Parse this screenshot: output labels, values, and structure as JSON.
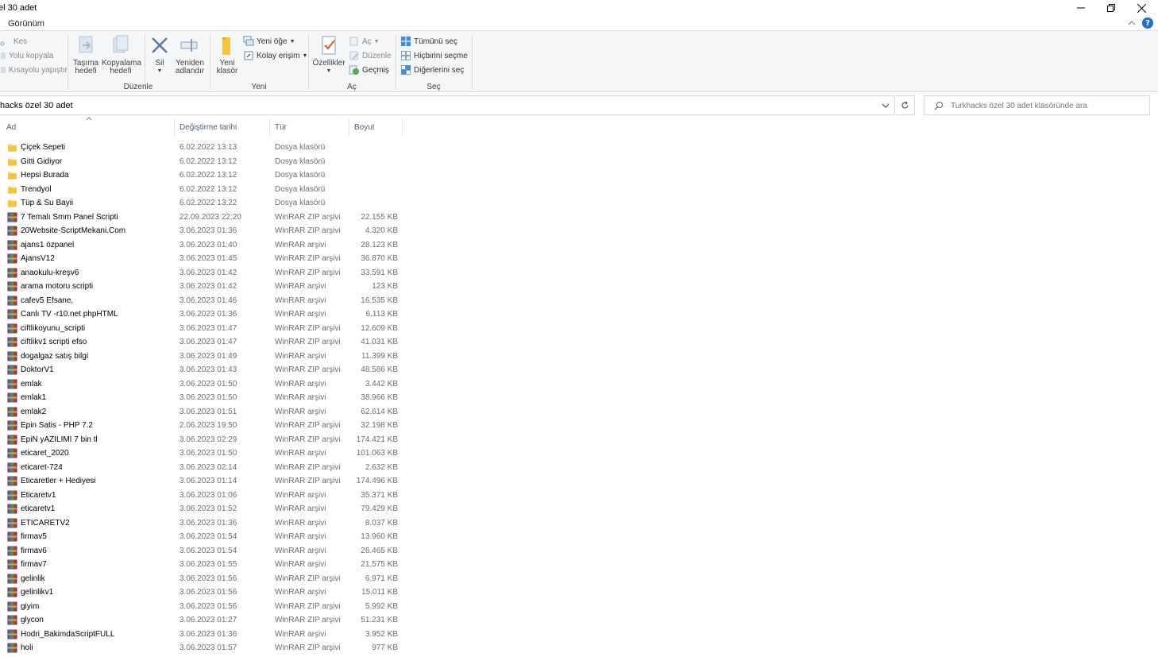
{
  "window": {
    "title": "el 30 adet",
    "controls": [
      "minimize",
      "restore",
      "close"
    ]
  },
  "ribbon": {
    "active_tab": "Görünüm",
    "help_label": "?",
    "groups": {
      "duzenle": {
        "label": "Düzenle",
        "clipboard_items": [
          {
            "label": "Kes",
            "icon": "scissors-icon"
          },
          {
            "label": "Yolu kopyala",
            "icon": "copy-path-icon"
          },
          {
            "label": "Kısayolu yapıştır",
            "icon": "paste-shortcut-icon"
          }
        ],
        "move_to": {
          "line1": "Taşıma",
          "line2": "hedefi"
        },
        "copy_to": {
          "line1": "Kopyalama",
          "line2": "hedefi"
        },
        "delete": {
          "line1": "Sil"
        },
        "rename": {
          "line1": "Yeniden",
          "line2": "adlandır"
        }
      },
      "yeni": {
        "label": "Yeni",
        "new_folder": {
          "line1": "Yeni",
          "line2": "klasör"
        },
        "new_item": "Yeni öğe",
        "easy_access": "Kolay erişim"
      },
      "ac": {
        "label": "Aç",
        "properties": "Özellikler",
        "open": "Aç",
        "edit": "Düzenle",
        "history": "Geçmiş"
      },
      "sec": {
        "label": "Seç",
        "select_all": "Tümünü seç",
        "select_none": "Hiçbirini seçme",
        "invert_selection": "Diğerlerini seç"
      }
    }
  },
  "address": {
    "path": "hacks özel 30 adet",
    "search_placeholder": "Turkhacks özel 30 adet klasöründe ara"
  },
  "columns": {
    "name": "Ad",
    "modified": "Değiştirme tarihi",
    "type": "Tür",
    "size": "Boyut"
  },
  "files": [
    {
      "name": "Çiçek Sepeti",
      "date": "6.02.2022 13:13",
      "type": "Dosya klasörü",
      "size": "",
      "icon": "folder-icon"
    },
    {
      "name": "Gitti Gidiyor",
      "date": "6.02.2022 13:12",
      "type": "Dosya klasörü",
      "size": "",
      "icon": "folder-icon"
    },
    {
      "name": "Hepsi Burada",
      "date": "6.02.2022 13:12",
      "type": "Dosya klasörü",
      "size": "",
      "icon": "folder-icon"
    },
    {
      "name": "Trendyol",
      "date": "6.02.2022 13:12",
      "type": "Dosya klasörü",
      "size": "",
      "icon": "folder-icon"
    },
    {
      "name": "Tüp & Su Bayii",
      "date": "6.02.2022 13:22",
      "type": "Dosya klasörü",
      "size": "",
      "icon": "folder-icon"
    },
    {
      "name": "7 Temalı Smm Panel Scripti",
      "date": "22.09.2023 22:20",
      "type": "WinRAR ZIP arşivi",
      "size": "22.155 KB",
      "icon": "winrar-archive-icon"
    },
    {
      "name": "20Website-ScriptMekani.Com",
      "date": "3.06.2023 01:36",
      "type": "WinRAR ZIP arşivi",
      "size": "4.320 KB",
      "icon": "winrar-archive-icon"
    },
    {
      "name": "ajans1 özpanel",
      "date": "3.06.2023 01:40",
      "type": "WinRAR arşivi",
      "size": "28.123 KB",
      "icon": "winrar-archive-icon"
    },
    {
      "name": "AjansV12",
      "date": "3.06.2023 01:45",
      "type": "WinRAR ZIP arşivi",
      "size": "36.870 KB",
      "icon": "winrar-archive-icon"
    },
    {
      "name": "anaokulu-kreşv6",
      "date": "3.06.2023 01:42",
      "type": "WinRAR ZIP arşivi",
      "size": "33.591 KB",
      "icon": "winrar-archive-icon"
    },
    {
      "name": "arama motoru scripti",
      "date": "3.06.2023 01:42",
      "type": "WinRAR arşivi",
      "size": "123 KB",
      "icon": "winrar-archive-icon"
    },
    {
      "name": "cafev5 Efsane,",
      "date": "3.06.2023 01:46",
      "type": "WinRAR arşivi",
      "size": "16.535 KB",
      "icon": "winrar-archive-icon"
    },
    {
      "name": "Canlı TV -r10.net phpHTML",
      "date": "3.06.2023 01:36",
      "type": "WinRAR arşivi",
      "size": "6.113 KB",
      "icon": "winrar-archive-icon"
    },
    {
      "name": "ciftlikoyunu_scripti",
      "date": "3.06.2023 01:47",
      "type": "WinRAR ZIP arşivi",
      "size": "12.609 KB",
      "icon": "winrar-archive-icon"
    },
    {
      "name": "ciftlikv1 scripti efso",
      "date": "3.06.2023 01:47",
      "type": "WinRAR ZIP arşivi",
      "size": "41.031 KB",
      "icon": "winrar-archive-icon"
    },
    {
      "name": "dogalgaz satış bilgi",
      "date": "3.06.2023 01:49",
      "type": "WinRAR arşivi",
      "size": "11.399 KB",
      "icon": "winrar-archive-icon"
    },
    {
      "name": "DoktorV1",
      "date": "3.06.2023 01:43",
      "type": "WinRAR ZIP arşivi",
      "size": "48.586 KB",
      "icon": "winrar-archive-icon"
    },
    {
      "name": "emlak",
      "date": "3.06.2023 01:50",
      "type": "WinRAR arşivi",
      "size": "3.442 KB",
      "icon": "winrar-archive-icon"
    },
    {
      "name": "emlak1",
      "date": "3.06.2023 01:50",
      "type": "WinRAR arşivi",
      "size": "38.966 KB",
      "icon": "winrar-archive-icon"
    },
    {
      "name": "emlak2",
      "date": "3.06.2023 01:51",
      "type": "WinRAR arşivi",
      "size": "62.614 KB",
      "icon": "winrar-archive-icon"
    },
    {
      "name": "Epin Satis - PHP 7.2",
      "date": "2.06.2023 19:50",
      "type": "WinRAR ZIP arşivi",
      "size": "32.198 KB",
      "icon": "winrar-archive-icon"
    },
    {
      "name": "EpiN yAZILIMI 7 bin tl",
      "date": "3.06.2023 02:29",
      "type": "WinRAR ZIP arşivi",
      "size": "174.421 KB",
      "icon": "winrar-archive-icon"
    },
    {
      "name": "eticaret_2020",
      "date": "3.06.2023 01:50",
      "type": "WinRAR arşivi",
      "size": "101.063 KB",
      "icon": "winrar-archive-icon"
    },
    {
      "name": "eticaret-724",
      "date": "3.06.2023 02:14",
      "type": "WinRAR ZIP arşivi",
      "size": "2.632 KB",
      "icon": "winrar-archive-icon"
    },
    {
      "name": "Eticaretler + Hediyesi",
      "date": "3.06.2023 01:14",
      "type": "WinRAR ZIP arşivi",
      "size": "174.496 KB",
      "icon": "winrar-archive-icon"
    },
    {
      "name": "Eticaretv1",
      "date": "3.06.2023 01:06",
      "type": "WinRAR arşivi",
      "size": "35.371 KB",
      "icon": "winrar-archive-icon"
    },
    {
      "name": "eticaretv1",
      "date": "3.06.2023 01:52",
      "type": "WinRAR arşivi",
      "size": "79.429 KB",
      "icon": "winrar-archive-icon"
    },
    {
      "name": "ETICARETV2",
      "date": "3.06.2023 01:36",
      "type": "WinRAR arşivi",
      "size": "8.037 KB",
      "icon": "winrar-archive-icon"
    },
    {
      "name": "firmav5",
      "date": "3.06.2023 01:54",
      "type": "WinRAR arşivi",
      "size": "13.960 KB",
      "icon": "winrar-archive-icon"
    },
    {
      "name": "firmav6",
      "date": "3.06.2023 01:54",
      "type": "WinRAR arşivi",
      "size": "26.465 KB",
      "icon": "winrar-archive-icon"
    },
    {
      "name": "firmav7",
      "date": "3.06.2023 01:55",
      "type": "WinRAR arşivi",
      "size": "21.575 KB",
      "icon": "winrar-archive-icon"
    },
    {
      "name": "gelinlik",
      "date": "3.06.2023 01:56",
      "type": "WinRAR ZIP arşivi",
      "size": "6.971 KB",
      "icon": "winrar-archive-icon"
    },
    {
      "name": "gelinlikv1",
      "date": "3.06.2023 01:56",
      "type": "WinRAR arşivi",
      "size": "15.011 KB",
      "icon": "winrar-archive-icon"
    },
    {
      "name": "giyim",
      "date": "3.06.2023 01:56",
      "type": "WinRAR ZIP arşivi",
      "size": "5.992 KB",
      "icon": "winrar-archive-icon"
    },
    {
      "name": "glycon",
      "date": "3.06.2023 01:27",
      "type": "WinRAR ZIP arşivi",
      "size": "51.231 KB",
      "icon": "winrar-archive-icon"
    },
    {
      "name": "Hodri_BakimdaScriptFULL",
      "date": "3.06.2023 01:36",
      "type": "WinRAR arşivi",
      "size": "3.952 KB",
      "icon": "winrar-archive-icon"
    },
    {
      "name": "holi",
      "date": "3.06.2023 01:57",
      "type": "WinRAR ZIP arşivi",
      "size": "977 KB",
      "icon": "winrar-archive-icon"
    }
  ]
}
